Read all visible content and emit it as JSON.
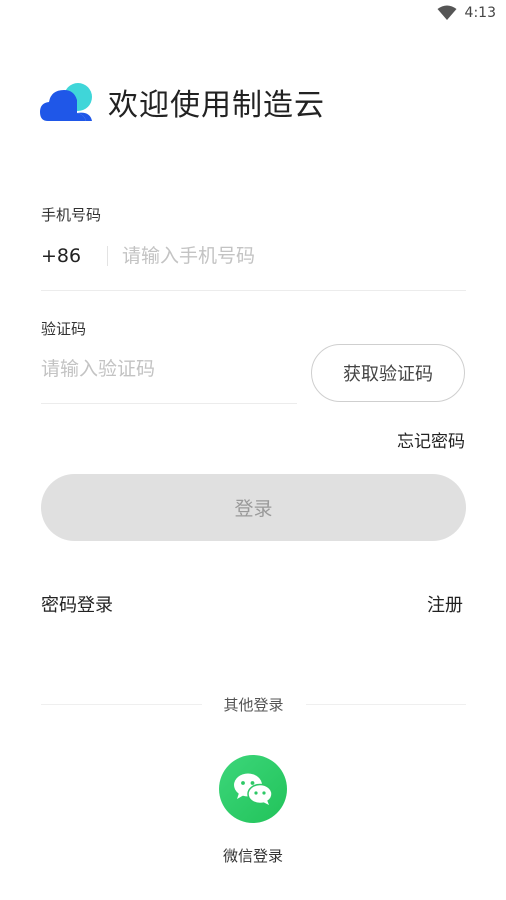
{
  "status_bar": {
    "time": "4:13",
    "wifi_icon": "wifi-icon"
  },
  "header": {
    "title": "欢迎使用制造云",
    "logo_icon": "cloud-logo-icon",
    "colors": {
      "logo_blue": "#1f57e8",
      "logo_cyan": "#3fd6d9"
    }
  },
  "phone": {
    "label": "手机号码",
    "country_code": "+86",
    "placeholder": "请输入手机号码",
    "value": ""
  },
  "code": {
    "label": "验证码",
    "placeholder": "请输入验证码",
    "value": "",
    "get_code_label": "获取验证码"
  },
  "forgot_password": "忘记密码",
  "login_button": "登录",
  "password_login": "密码登录",
  "register": "注册",
  "other_login": {
    "divider_label": "其他登录",
    "wechat_icon": "wechat-icon",
    "wechat_label": "微信登录",
    "wechat_color": "#2ec866"
  }
}
